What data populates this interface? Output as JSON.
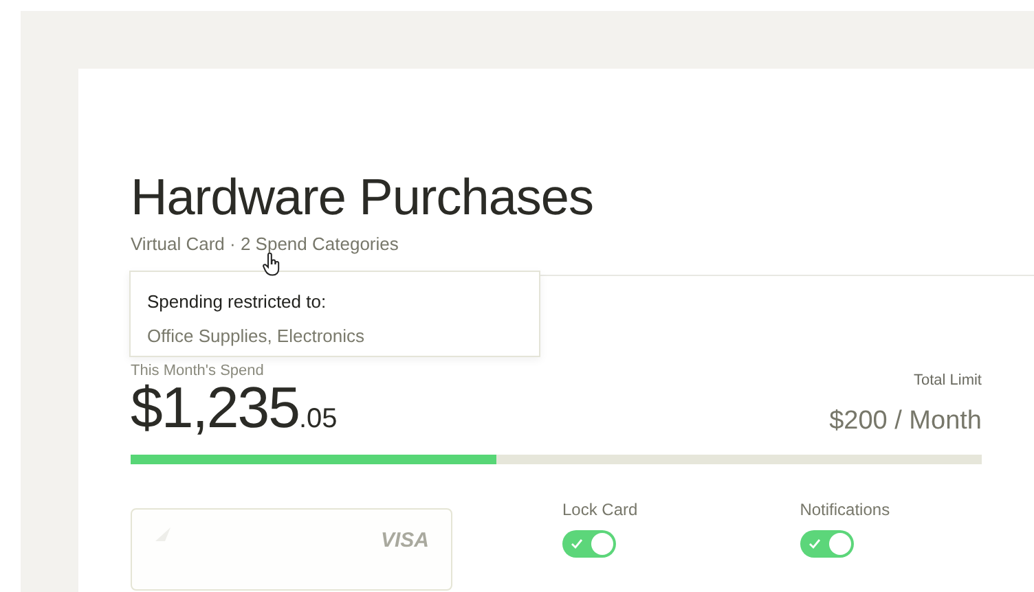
{
  "title": "Hardware Purchases",
  "subtitle": "Virtual Card · 2 Spend Categories",
  "tooltip": {
    "heading": "Spending restricted to:",
    "text": "Office Supplies, Electronics"
  },
  "spend": {
    "label": "This Month's Spend",
    "amount": "$1,235",
    "cents": ".05",
    "limit_label": "Total Limit",
    "limit": "$200 / Month",
    "level": 0.43
  },
  "card": {
    "brand": "VISA"
  },
  "toggles": [
    {
      "label": "Lock Card",
      "on": true
    },
    {
      "label": "Notifications",
      "on": true
    }
  ]
}
